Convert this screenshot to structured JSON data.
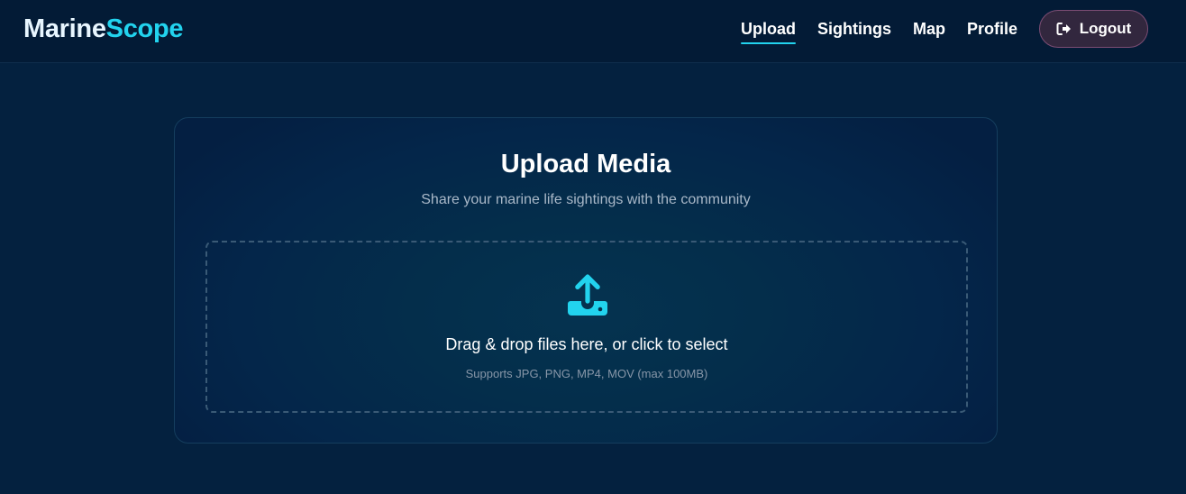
{
  "brand": {
    "part1": "Marine",
    "part2": "Scope"
  },
  "nav": {
    "items": [
      {
        "label": "Upload",
        "active": true
      },
      {
        "label": "Sightings",
        "active": false
      },
      {
        "label": "Map",
        "active": false
      },
      {
        "label": "Profile",
        "active": false
      }
    ],
    "logout_label": "Logout"
  },
  "upload": {
    "title": "Upload Media",
    "subtitle": "Share your marine life sightings with the community",
    "dropzone_text": "Drag & drop files here, or click to select",
    "dropzone_hint": "Supports JPG, PNG, MP4, MOV (max 100MB)",
    "icon": "upload-icon"
  },
  "colors": {
    "accent": "#22d3ee",
    "background": "#04213f",
    "navbar": "#031b36",
    "logout_bg": "#32273e",
    "logout_border": "#7c4d74"
  }
}
